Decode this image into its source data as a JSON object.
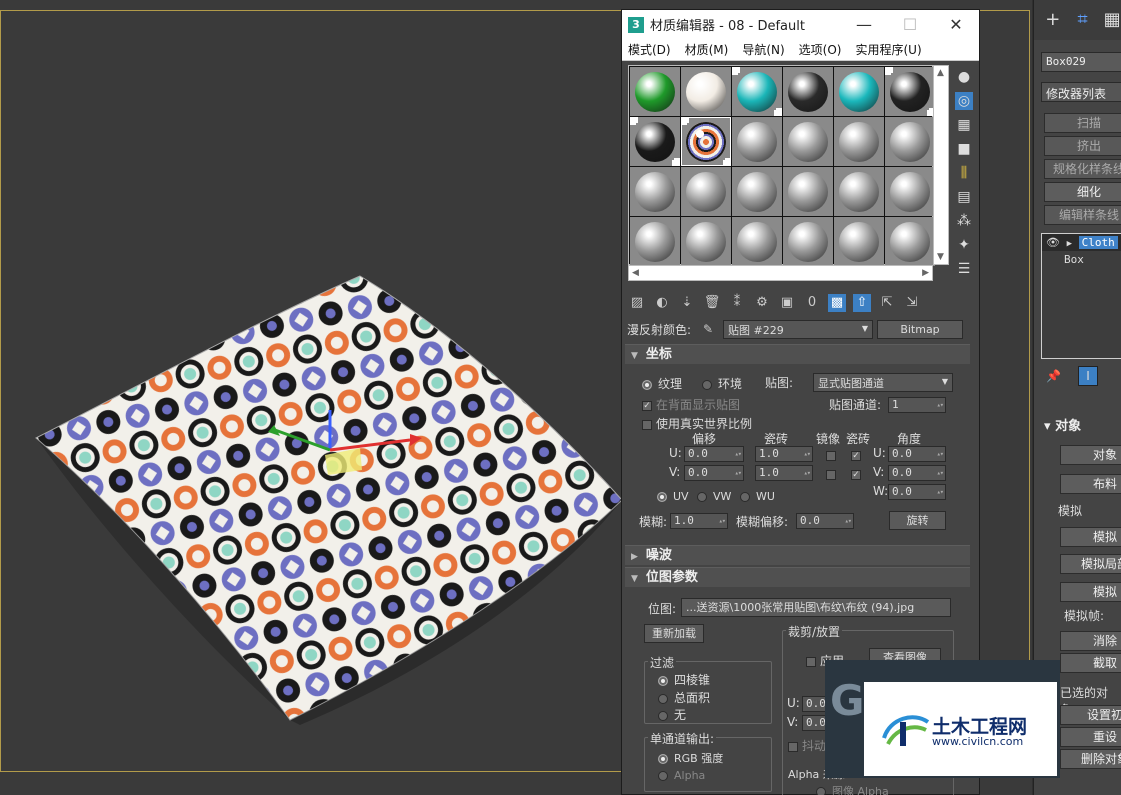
{
  "window": {
    "title": "材质编辑器 - 08 - Default",
    "icon_text": "3",
    "minimize": "—",
    "maximize": "☐",
    "close": "✕"
  },
  "menu": [
    "模式(D)",
    "材质(M)",
    "导航(N)",
    "选项(O)",
    "实用程序(U)"
  ],
  "slots": [
    {
      "color": "#1f9a2a",
      "used": false
    },
    {
      "color": "#f2ece4",
      "used": false
    },
    {
      "color": "#1bb6b8",
      "used": true
    },
    {
      "color": "#2a2a2a",
      "used": false
    },
    {
      "color": "#1bb8bc",
      "used": false
    },
    {
      "color": "#222222",
      "used": true
    },
    {
      "color": "#1a1a1a",
      "used": true
    },
    {
      "color": "pattern",
      "used": true
    },
    {
      "color": "#9a9a9a",
      "used": false
    },
    {
      "color": "#9a9a9a",
      "used": false
    },
    {
      "color": "#9a9a9a",
      "used": false
    },
    {
      "color": "#9a9a9a",
      "used": false
    },
    {
      "color": "#9a9a9a",
      "used": false
    },
    {
      "color": "#9a9a9a",
      "used": false
    },
    {
      "color": "#9a9a9a",
      "used": false
    },
    {
      "color": "#9a9a9a",
      "used": false
    },
    {
      "color": "#9a9a9a",
      "used": false
    },
    {
      "color": "#9a9a9a",
      "used": false
    },
    {
      "color": "#9a9a9a",
      "used": false
    },
    {
      "color": "#9a9a9a",
      "used": false
    },
    {
      "color": "#9a9a9a",
      "used": false
    },
    {
      "color": "#9a9a9a",
      "used": false
    },
    {
      "color": "#9a9a9a",
      "used": false
    },
    {
      "color": "#9a9a9a",
      "used": false
    }
  ],
  "diffuse": {
    "label": "漫反射颜色:",
    "map_name": "贴图 #229",
    "map_type": "Bitmap"
  },
  "coords": {
    "title": "坐标",
    "texture": "纹理",
    "environ": "环境",
    "mapping_label": "贴图:",
    "mapping_value": "显式贴图通道",
    "show_back": "在背面显示贴图",
    "map_channel_label": "贴图通道:",
    "map_channel_value": "1",
    "real_world": "使用真实世界比例",
    "offset": "偏移",
    "tiling": "瓷砖",
    "mirror": "镜像",
    "tile": "瓷砖",
    "angle": "角度",
    "u": "U:",
    "v": "V:",
    "w": "W:",
    "u_offset": "0.0",
    "v_offset": "0.0",
    "u_tiling": "1.0",
    "v_tiling": "1.0",
    "u_angle": "0.0",
    "v_angle": "0.0",
    "w_angle": "0.0",
    "uv": "UV",
    "vw": "VW",
    "wu": "WU",
    "blur_label": "模糊:",
    "blur_value": "1.0",
    "blur_offset_label": "模糊偏移:",
    "blur_offset_value": "0.0",
    "rotate": "旋转"
  },
  "noise": {
    "title": "噪波"
  },
  "bitmap": {
    "title": "位图参数",
    "path_label": "位图:",
    "path": "...送资源\\1000张常用贴图\\布纹\\布纹 (94).jpg",
    "reload": "重新加载",
    "crop_title": "裁剪/放置",
    "apply": "应用",
    "view_image": "查看图像",
    "u_label": "U:",
    "v_label": "V:",
    "u_val": "0.0",
    "v_val": "0.0",
    "jitter": "抖动",
    "filter_title": "过滤",
    "pyramid": "四棱锥",
    "summed": "总面积",
    "none": "无",
    "mono_title": "单通道输出:",
    "rgb": "RGB 强度",
    "alpha": "Alpha",
    "alpha_source": "Alpha 来源",
    "image_alpha": "图像 Alpha"
  },
  "cmd": {
    "object_name": "Box029",
    "modifier_list": "修改器列表",
    "buttons": [
      "扫描",
      "挤出",
      "规格化样条线",
      "细化",
      "编辑样条线"
    ],
    "stack_top": "Cloth",
    "stack_base": "Box",
    "object_section": "对象",
    "object_btn": "对象",
    "cloth_btn": "布料",
    "sim_section": "模拟",
    "sim_btn": "模拟",
    "sim_local": "模拟局部",
    "sim_btn2": "模拟",
    "sim_frames": "模拟帧:",
    "erase": "消除",
    "grab": "截取",
    "selected_obj": "已选的对象:",
    "set_init": "设置初",
    "reset": "重设",
    "delete_obj": "删除对象"
  },
  "watermark": {
    "title": "土木工程网",
    "url": "www.civilcn.com"
  }
}
